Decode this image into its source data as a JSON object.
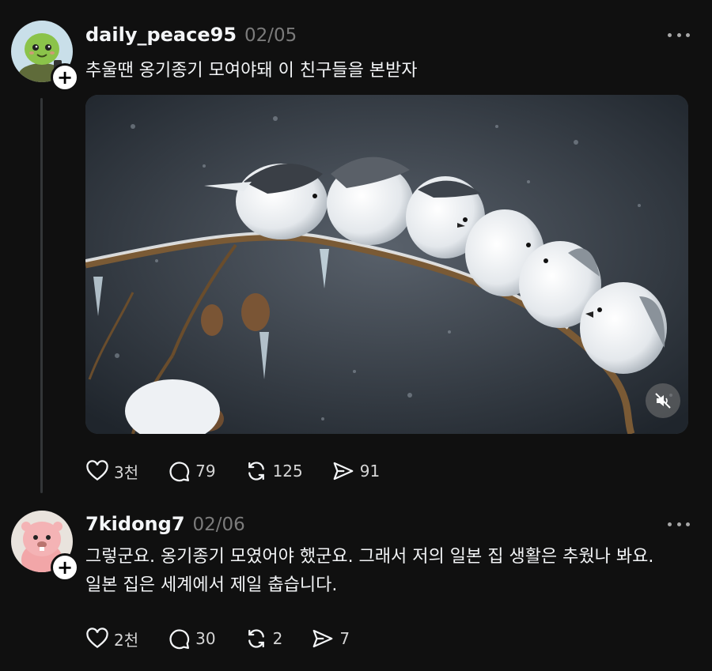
{
  "posts": [
    {
      "username": "daily_peace95",
      "date": "02/05",
      "text": "추울땐 옹기종기 모여야돼 이 친구들을 본받자",
      "avatar_icon": "green-turtle-character",
      "follow_icon": "plus-icon",
      "media": {
        "type": "video",
        "description_icon": "birds-on-snowy-branch-image",
        "sound_state": "muted"
      },
      "actions": {
        "like": "3천",
        "comment": "79",
        "repost": "125",
        "share": "91"
      }
    },
    {
      "username": "7kidong7",
      "date": "02/06",
      "text_line1": "그렇군요. 옹기종기 모였어야 했군요. 그래서 저의 일본 집 생활은 추웠나 봐요.",
      "text_line2": "일본 집은 세계에서 제일 춥습니다.",
      "avatar_icon": "pink-beaver-character",
      "follow_icon": "plus-icon",
      "actions": {
        "like": "2천",
        "comment": "30",
        "repost": "2",
        "share": "7"
      }
    }
  ],
  "colors": {
    "background": "#101010",
    "text": "#f3f5f7",
    "muted": "#7b7b7b",
    "thread_line": "#333638"
  }
}
